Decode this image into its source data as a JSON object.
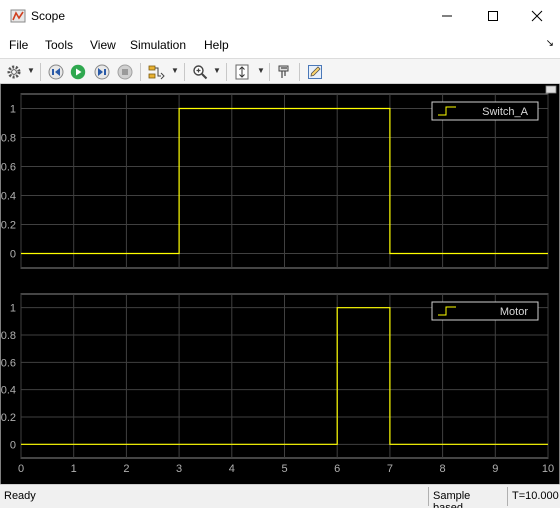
{
  "window": {
    "title": "Scope"
  },
  "menu": {
    "items": [
      "File",
      "Tools",
      "View",
      "Simulation",
      "Help"
    ]
  },
  "toolbar": {
    "icons": [
      "gear-icon",
      "step-back-icon",
      "run-icon",
      "step-forward-icon",
      "stop-icon",
      "highlight-signal-icon",
      "zoom-in-icon",
      "autoscale-axes-icon",
      "style-icon",
      "edit-icon"
    ]
  },
  "colors": {
    "background": "#000000",
    "signal": "#ffff00",
    "grid": "#404040",
    "ticks": "#b0b0b0"
  },
  "chart_data": [
    {
      "type": "line",
      "step": true,
      "series": [
        {
          "name": "Switch_A",
          "x": [
            0,
            3,
            3,
            7,
            7,
            10
          ],
          "y": [
            0,
            0,
            1,
            1,
            0,
            0
          ]
        }
      ],
      "xlim": [
        0,
        10
      ],
      "ylim": [
        -0.1,
        1.1
      ],
      "yticks": [
        "0",
        "0.2",
        "0.4",
        "0.6",
        "0.8",
        "1"
      ],
      "xticks": [],
      "grid": true,
      "legend": "top-right"
    },
    {
      "type": "line",
      "step": true,
      "series": [
        {
          "name": "Motor",
          "x": [
            0,
            6,
            6,
            7,
            7,
            10
          ],
          "y": [
            0,
            0,
            1,
            1,
            0,
            0
          ]
        }
      ],
      "xlim": [
        0,
        10
      ],
      "ylim": [
        -0.1,
        1.1
      ],
      "yticks": [
        "0",
        "0.2",
        "0.4",
        "0.6",
        "0.8",
        "1"
      ],
      "xticks": [
        "0",
        "1",
        "2",
        "3",
        "4",
        "5",
        "6",
        "7",
        "8",
        "9",
        "10"
      ],
      "grid": true,
      "legend": "top-right"
    }
  ],
  "status": {
    "left": "Ready",
    "mode": "Sample based",
    "time": "T=10.000"
  }
}
